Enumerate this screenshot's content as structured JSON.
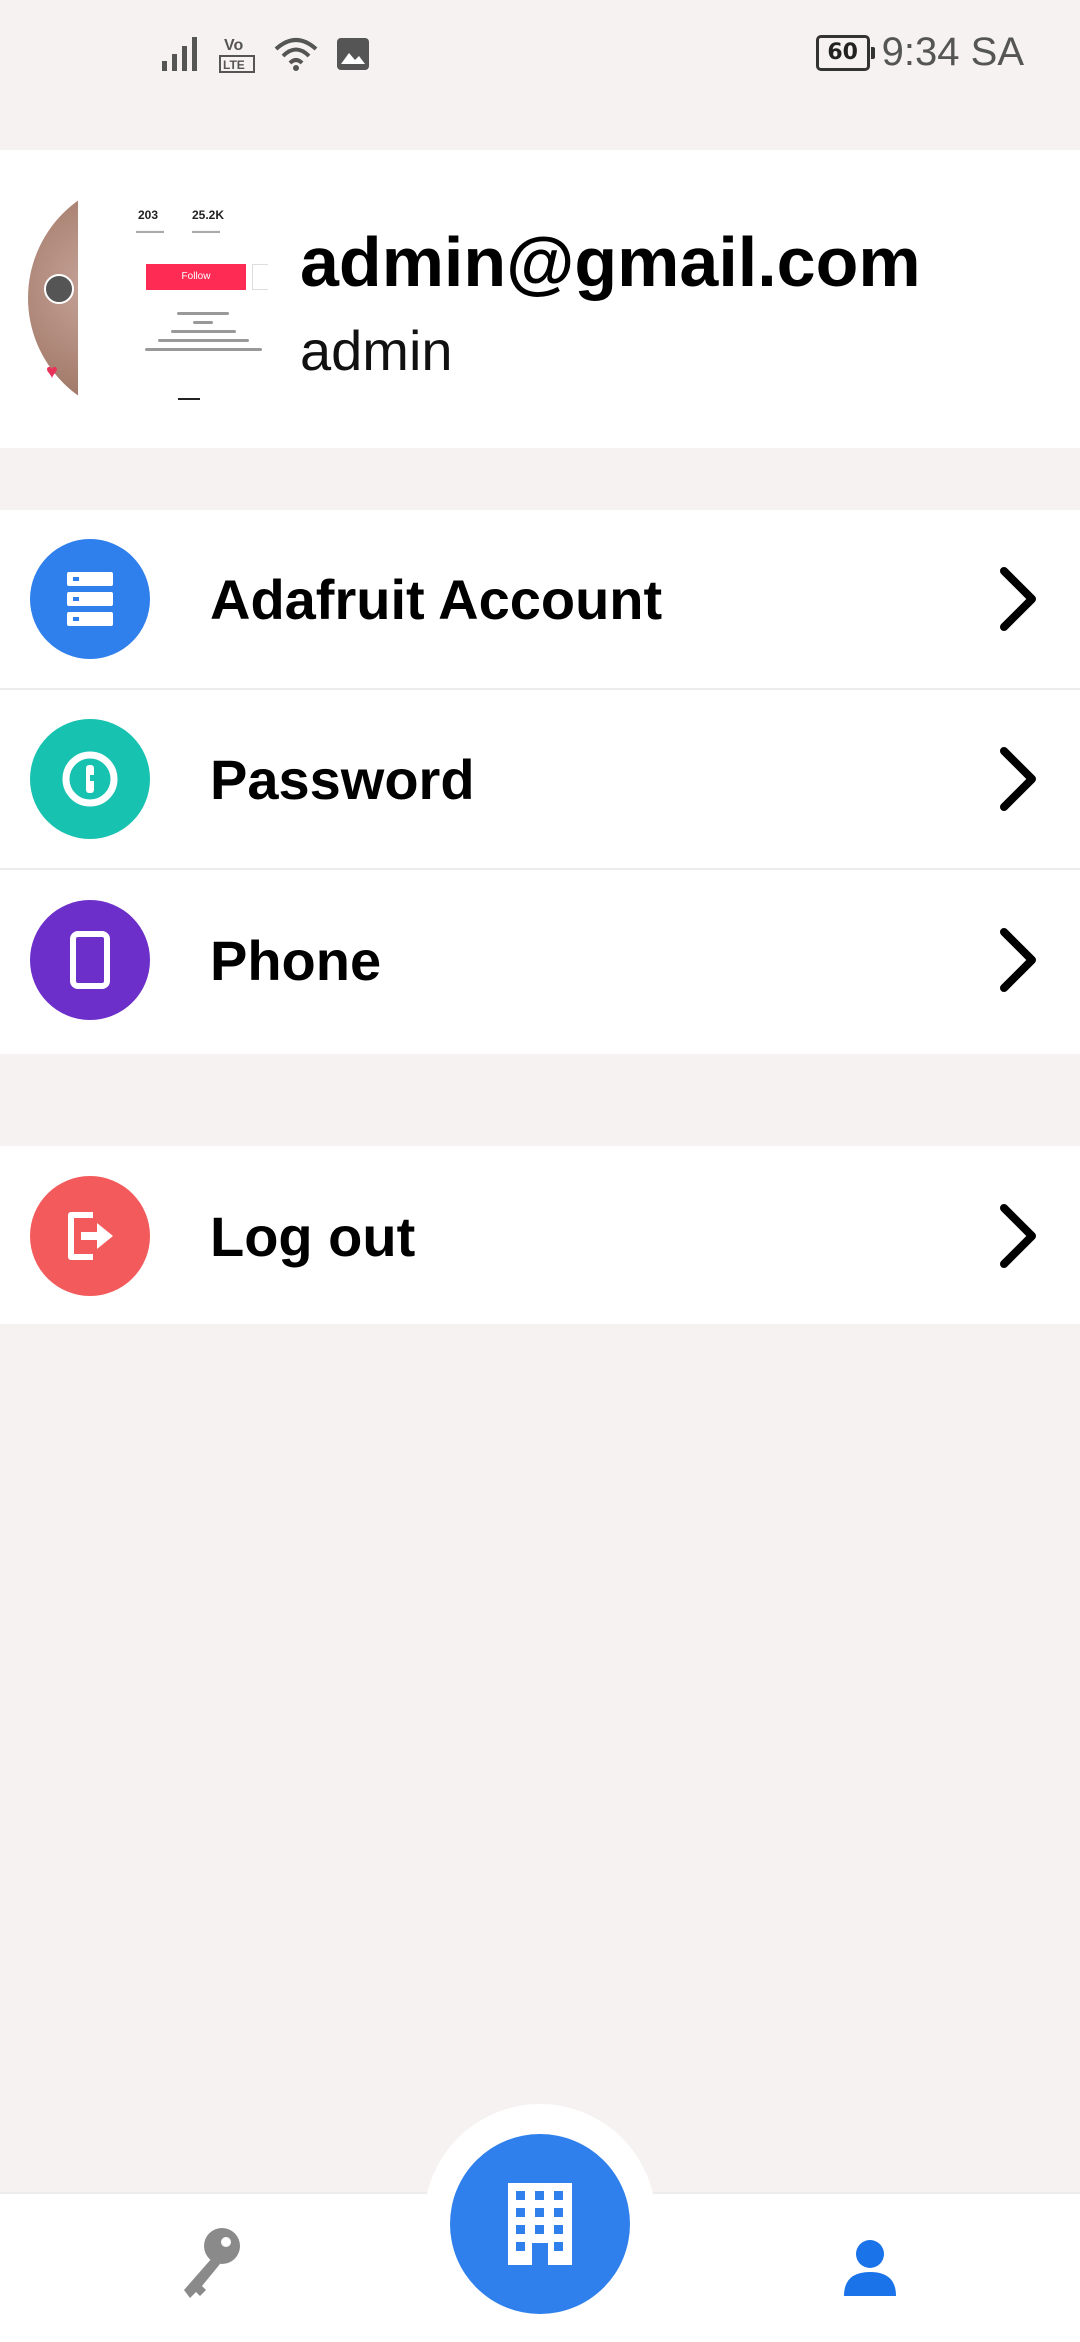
{
  "status_bar": {
    "battery": "60",
    "time": "9:34 SA",
    "icons": [
      "signal-icon",
      "volte-lte-icon",
      "wifi-icon",
      "gallery-notification-icon"
    ]
  },
  "profile": {
    "email": "admin@gmail.com",
    "name": "admin",
    "avatar": {
      "following_count": "203",
      "followers_count": "25.2K",
      "follow_label": "Follow"
    }
  },
  "menu": {
    "primary": [
      {
        "label": "Adafruit Account",
        "icon": "server-icon",
        "color": "#2f80ed"
      },
      {
        "label": "Password",
        "icon": "password-keyhole-icon",
        "color": "#17c2b0"
      },
      {
        "label": "Phone",
        "icon": "phone-icon",
        "color": "#6d2fc9"
      }
    ],
    "secondary": [
      {
        "label": "Log out",
        "icon": "logout-icon",
        "color": "#f35a5c"
      }
    ]
  },
  "bottom_nav": {
    "items": [
      {
        "name": "key-icon",
        "color": "#8a8a8a",
        "active": false
      },
      {
        "name": "building-icon",
        "color": "#2f80ed",
        "active": false
      },
      {
        "name": "profile-icon",
        "color": "#1a73e8",
        "active": true
      }
    ]
  },
  "colors": {
    "background": "#f6f2f1",
    "accent": "#2f80ed"
  }
}
